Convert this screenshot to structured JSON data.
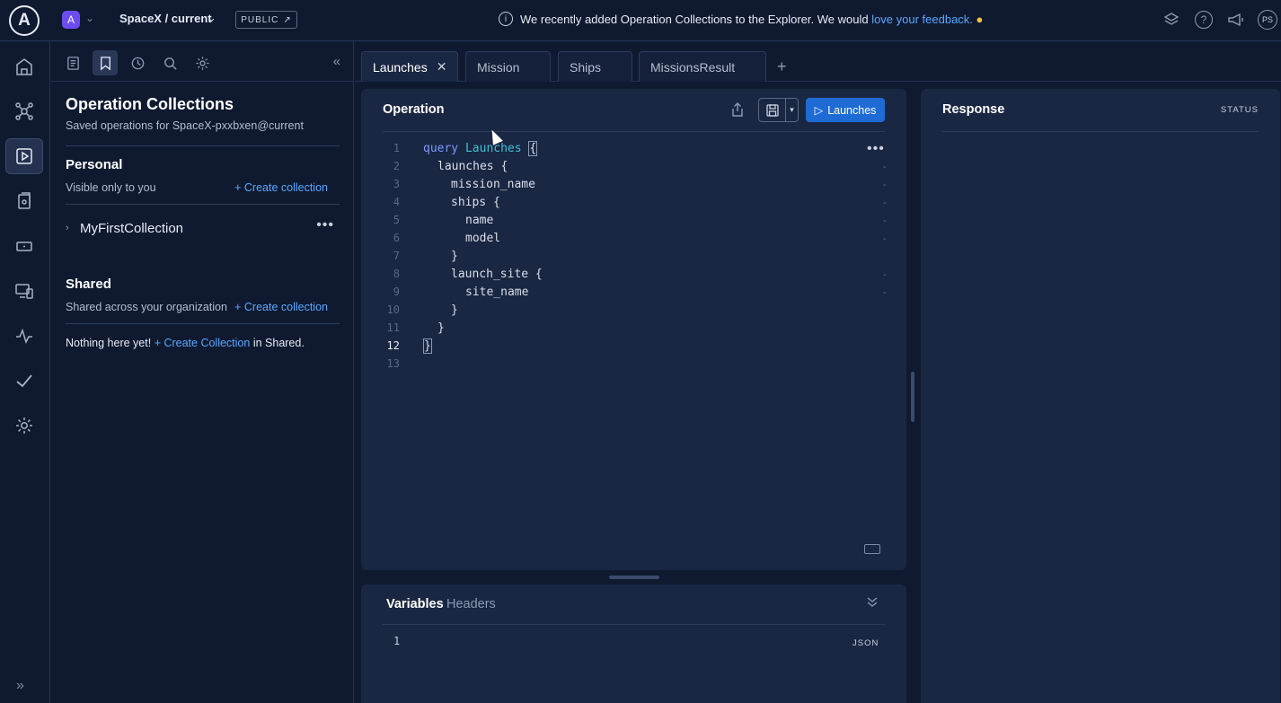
{
  "topbar": {
    "logo_letter": "A",
    "graph_avatar": "A",
    "graph_name": "SpaceX / current",
    "public_badge": "PUBLIC",
    "notice_text": "We recently added Operation Collections to the Explorer. We would",
    "notice_link": "love your feedback.",
    "user_initials": "PS"
  },
  "panel": {
    "title": "Operation Collections",
    "subtitle": "Saved operations for SpaceX-pxxbxen@current",
    "personal": {
      "title": "Personal",
      "subtitle": "Visible only to you",
      "create_label": "+ Create collection",
      "collections": [
        {
          "name": "MyFirstCollection"
        }
      ]
    },
    "shared": {
      "title": "Shared",
      "subtitle": "Shared across your organization",
      "create_label": "+ Create collection",
      "empty_prefix": "Nothing here yet!",
      "empty_link": "+ Create Collection",
      "empty_suffix": "in Shared."
    }
  },
  "tabs": [
    {
      "label": "Launches",
      "active": true
    },
    {
      "label": "Mission",
      "active": false
    },
    {
      "label": "Ships",
      "active": false
    },
    {
      "label": "MissionsResult",
      "active": false
    }
  ],
  "operation": {
    "title": "Operation",
    "run_label": "Launches",
    "lines": [
      {
        "n": "1",
        "text": "query Launches {"
      },
      {
        "n": "2",
        "text": "  launches {"
      },
      {
        "n": "3",
        "text": "    mission_name"
      },
      {
        "n": "4",
        "text": "    ships {"
      },
      {
        "n": "5",
        "text": "      name"
      },
      {
        "n": "6",
        "text": "      model"
      },
      {
        "n": "7",
        "text": "    }"
      },
      {
        "n": "8",
        "text": "    launch_site {"
      },
      {
        "n": "9",
        "text": "      site_name"
      },
      {
        "n": "10",
        "text": "    }"
      },
      {
        "n": "11",
        "text": "  }"
      },
      {
        "n": "12",
        "text": "}"
      },
      {
        "n": "13",
        "text": ""
      }
    ]
  },
  "variables": {
    "tab_variables": "Variables",
    "tab_headers": "Headers",
    "line_number": "1",
    "format_label": "JSON"
  },
  "response": {
    "title": "Response",
    "status_label": "STATUS"
  },
  "colors": {
    "background": "#0f1a30",
    "card": "#1a2742",
    "accent": "#1f6bd6",
    "link": "#5aa7ff"
  }
}
